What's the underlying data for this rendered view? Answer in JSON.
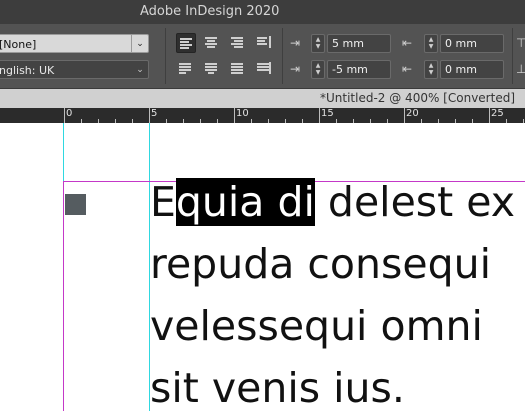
{
  "app": {
    "title": "Adobe InDesign 2020"
  },
  "control_panel": {
    "char_style": "[None]",
    "language": "nglish: UK",
    "left_indent": "5 mm",
    "first_line_indent": "-5 mm",
    "right_indent": "0 mm",
    "last_line_indent": "0 mm"
  },
  "document": {
    "tab_title": "*Untitled-2 @ 400% [Converted]"
  },
  "ruler": {
    "labels": [
      "0",
      "5",
      "10",
      "15",
      "20",
      "25"
    ]
  },
  "text": {
    "line1_pre": "E",
    "line1_selected": "quia di",
    "line1_post": " delest ex",
    "line2": "repuda consequi",
    "line3": "velessequi omni",
    "line4": "sit venis ius."
  },
  "colors": {
    "selection": "#000000",
    "guide": "#2fd8e0",
    "margin": "#c438c8",
    "bullet": "#555c60"
  }
}
